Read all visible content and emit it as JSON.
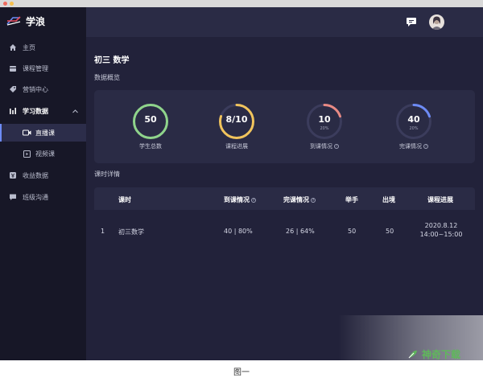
{
  "app": {
    "brand": "学浪"
  },
  "sidebar": {
    "items": [
      {
        "label": "主页",
        "icon": "home-icon"
      },
      {
        "label": "课程管理",
        "icon": "calendar-icon"
      },
      {
        "label": "营销中心",
        "icon": "tag-icon"
      },
      {
        "label": "学习数据",
        "icon": "bar-chart-icon"
      },
      {
        "label": "直播课",
        "icon": "video-camera-icon"
      },
      {
        "label": "视频课",
        "icon": "play-video-icon"
      },
      {
        "label": "收益数据",
        "icon": "revenue-icon"
      },
      {
        "label": "班级沟通",
        "icon": "chat-icon"
      }
    ]
  },
  "page": {
    "title": "初三 数学",
    "overview_label": "数据概览",
    "detail_label": "课时详情"
  },
  "stats": [
    {
      "value": "50",
      "pct": "",
      "label": "学生总数",
      "color": "#8fd48b",
      "fraction": 1.0
    },
    {
      "value": "8/10",
      "pct": "",
      "label": "课程进展",
      "color": "#f1c45c",
      "fraction": 0.8
    },
    {
      "value": "10",
      "pct": "20%",
      "label": "到课情况",
      "color": "#e98a84",
      "fraction": 0.2
    },
    {
      "value": "40",
      "pct": "20%",
      "label": "完课情况",
      "color": "#6d8bf5",
      "fraction": 0.2
    }
  ],
  "table": {
    "headers": [
      "课时",
      "到课情况",
      "完课情况",
      "举手",
      "出境",
      "课程进展"
    ],
    "rows": [
      {
        "index": "1",
        "lesson": "初三数学",
        "attendance": "40 | 80%",
        "completion": "26 | 64%",
        "hands": "50",
        "on_camera": "50",
        "date": "2020.8.12",
        "time": "14:00~15:00"
      }
    ]
  },
  "watermark": {
    "text": "神奇下载"
  },
  "caption": "图一"
}
